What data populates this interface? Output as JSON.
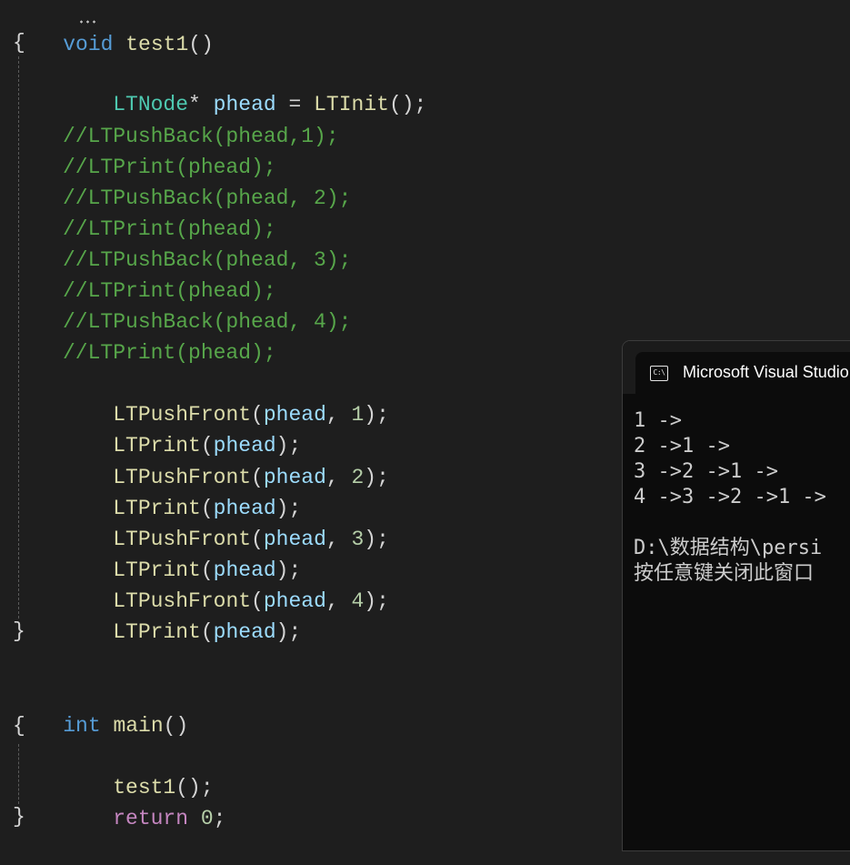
{
  "editor": {
    "test1_header": {
      "keyword": "void",
      "name": "test1",
      "parens": "()"
    },
    "brace_open": "{",
    "brace_close": "}",
    "decl": {
      "type": "LTNode",
      "star": "*",
      "var": "phead",
      "eq": "=",
      "fn": "LTInit",
      "tail": "();"
    },
    "comments": [
      "//LTPushBack(phead,1);",
      "//LTPrint(phead);",
      "//LTPushBack(phead, 2);",
      "//LTPrint(phead);",
      "//LTPushBack(phead, 3);",
      "//LTPrint(phead);",
      "//LTPushBack(phead, 4);",
      "//LTPrint(phead);"
    ],
    "calls": [
      {
        "fn": "LTPushFront",
        "open": "(",
        "arg": "phead",
        "sep": ", ",
        "num": "1",
        "close": ");"
      },
      {
        "fn": "LTPrint",
        "open": "(",
        "arg": "phead",
        "close": ");"
      },
      {
        "fn": "LTPushFront",
        "open": "(",
        "arg": "phead",
        "sep": ", ",
        "num": "2",
        "close": ");"
      },
      {
        "fn": "LTPrint",
        "open": "(",
        "arg": "phead",
        "close": ");"
      },
      {
        "fn": "LTPushFront",
        "open": "(",
        "arg": "phead",
        "sep": ", ",
        "num": "3",
        "close": ");"
      },
      {
        "fn": "LTPrint",
        "open": "(",
        "arg": "phead",
        "close": ");"
      },
      {
        "fn": "LTPushFront",
        "open": "(",
        "arg": "phead",
        "sep": ", ",
        "num": "4",
        "close": ");"
      },
      {
        "fn": "LTPrint",
        "open": "(",
        "arg": "phead",
        "close": ");"
      }
    ],
    "main_header": {
      "keyword": "int",
      "name": "main",
      "parens": "()"
    },
    "main_call": {
      "fn": "test1",
      "tail": "();"
    },
    "main_return": {
      "keyword": "return",
      "num": "0",
      "tail": ";"
    }
  },
  "console": {
    "title": "Microsoft Visual Studio",
    "icon": "console-icon",
    "icon_text": "C:\\",
    "lines": [
      "1 ->",
      "2 ->1 ->",
      "3 ->2 ->1 ->",
      "4 ->3 ->2 ->1 ->",
      "",
      "D:\\数据结构\\persi",
      "按任意键关闭此窗口"
    ]
  }
}
